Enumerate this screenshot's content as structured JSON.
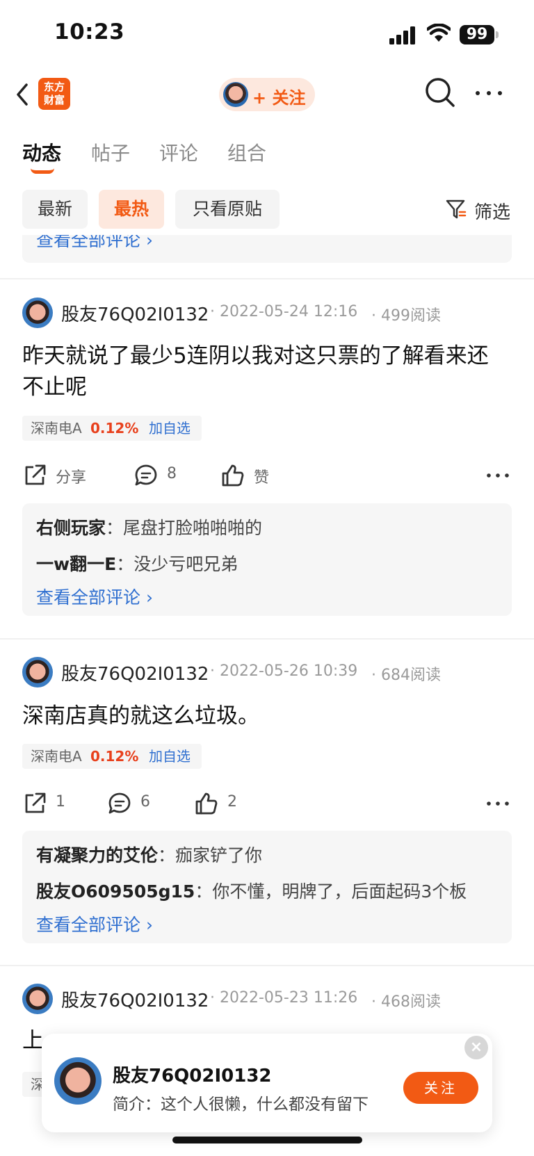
{
  "status_bar": {
    "time": "10:23",
    "battery": "99"
  },
  "nav": {
    "logo_line1": "东方",
    "logo_line2": "财富",
    "follow_label": "+ 关注"
  },
  "tabs": [
    {
      "label": "动态",
      "active": true
    },
    {
      "label": "帖子",
      "active": false
    },
    {
      "label": "评论",
      "active": false
    },
    {
      "label": "组合",
      "active": false
    }
  ],
  "filters": {
    "chips": [
      {
        "label": "最新",
        "active": false
      },
      {
        "label": "最热",
        "active": true
      },
      {
        "label": "只看原贴",
        "active": false
      }
    ],
    "filter_label": "筛选"
  },
  "prev_card": {
    "view_all": "查看全部评论 ›"
  },
  "posts": [
    {
      "author": "股友76Q02I0132",
      "date": "2022-05-24 12:16",
      "reads": "499阅读",
      "body": "昨天就说了最少5连阴以我对这只票的了解看来还不止呢",
      "stock": {
        "name": "深南电A",
        "change": "0.12%",
        "add": "加自选"
      },
      "share": "分享",
      "comments": "8",
      "likes": "赞",
      "replies": [
        {
          "user": "右侧玩家",
          "text": "尾盘打脸啪啪啪的"
        },
        {
          "user": "一w翻一E",
          "text": "没少亏吧兄弟"
        }
      ],
      "view_all": "查看全部评论 ›"
    },
    {
      "author": "股友76Q02I0132",
      "date": "2022-05-26 10:39",
      "reads": "684阅读",
      "body": "深南店真的就这么垃圾。",
      "stock": {
        "name": "深南电A",
        "change": "0.12%",
        "add": "加自选"
      },
      "share": "1",
      "comments": "6",
      "likes": "2",
      "replies": [
        {
          "user": "有凝聚力的艾伦",
          "text": "痂家铲了你"
        },
        {
          "user": "股友O609505g15",
          "text": "你不懂，明牌了，后面起码3个板"
        }
      ],
      "view_all": "查看全部评论 ›"
    },
    {
      "author": "股友76Q02I0132",
      "date": "2022-05-23 11:26",
      "reads": "468阅读",
      "body": "上",
      "stock_partial": "深"
    }
  ],
  "popup": {
    "name": "股友76Q02I0132",
    "bio": "简介：这个人很懒，什么都没有留下",
    "follow": "关注",
    "close": "×"
  },
  "colors": {
    "accent": "#f25a14",
    "link": "#2f6fd0",
    "up": "#e8401c"
  }
}
